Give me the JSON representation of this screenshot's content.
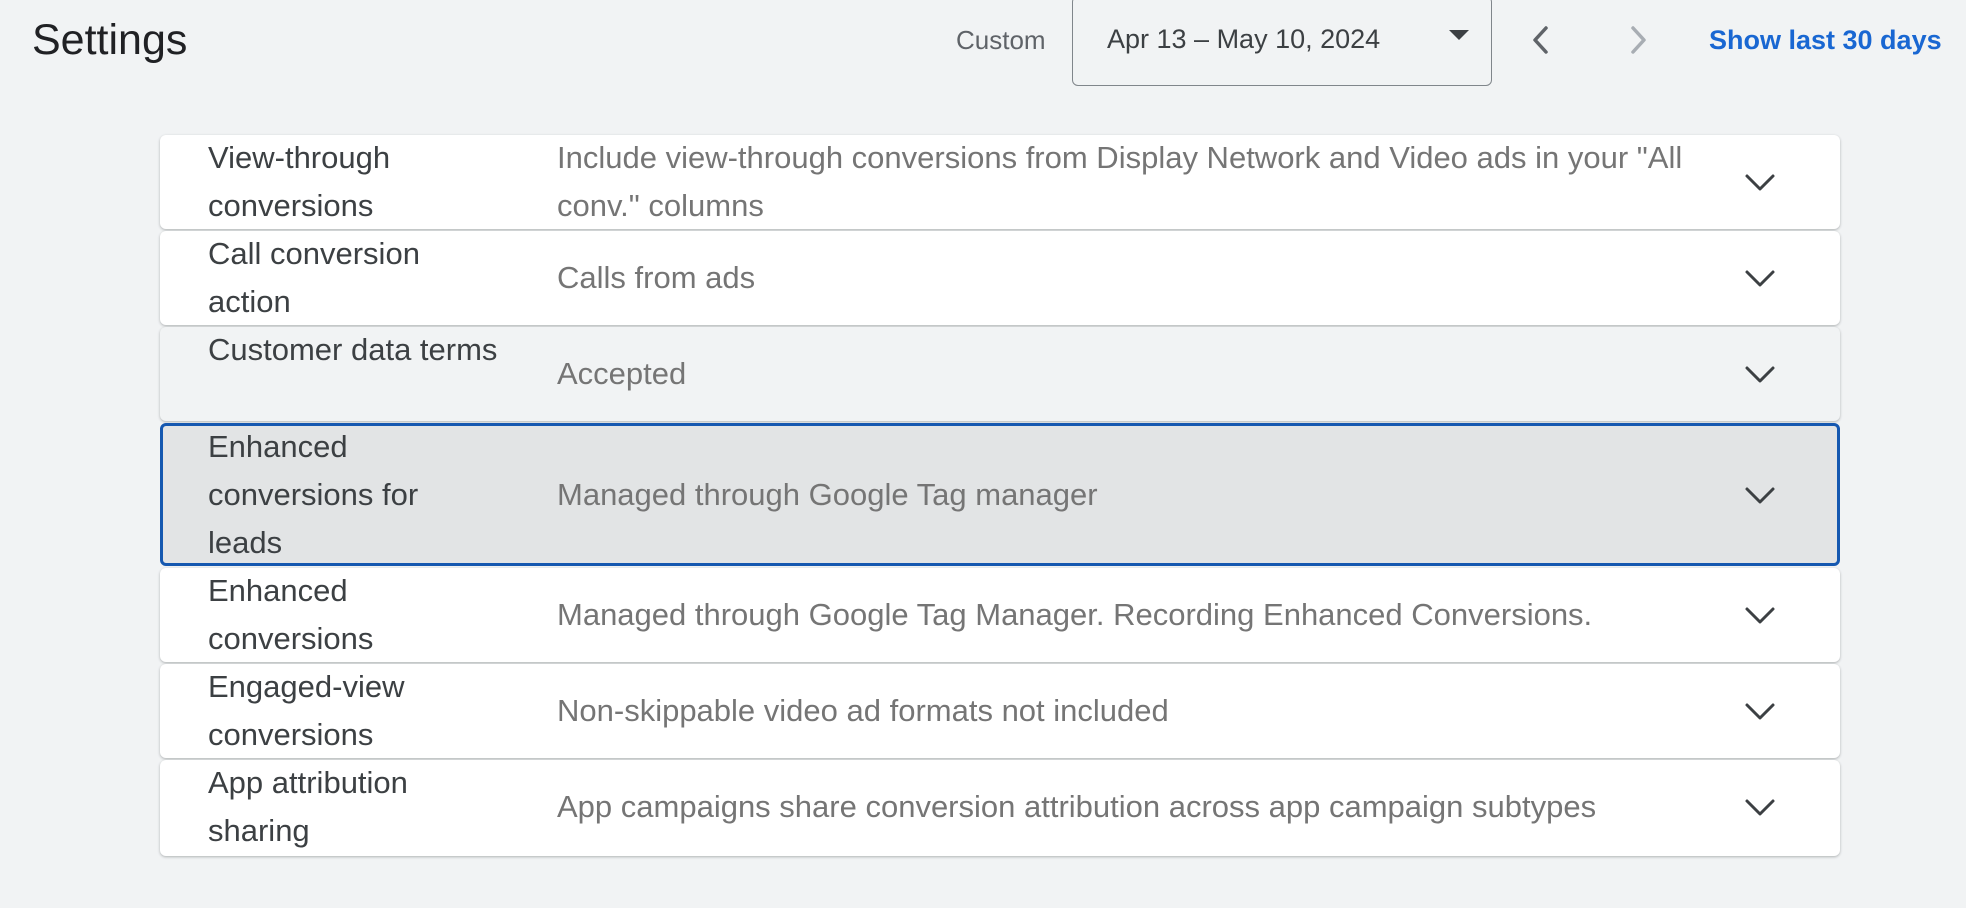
{
  "header": {
    "title": "Settings",
    "date_range_label": "Custom",
    "date_range_value": "Apr 13 – May 10, 2024",
    "show_last_label": "Show last 30 days"
  },
  "icons": {
    "date_dropdown": "caret-down-icon",
    "previous": "chevron-left-icon",
    "next": "chevron-right-icon",
    "expand": "chevron-down-icon"
  },
  "colors": {
    "background": "#f1f3f4",
    "link": "#1967d2",
    "selected_border": "#1558b0",
    "selected_background": "#e2e4e5",
    "value_text": "#757575"
  },
  "settings": {
    "rows": [
      {
        "name": "View-through conversions",
        "value": "Include view-through conversions from Display Network and Video ads in your \"All conv.\" columns"
      },
      {
        "name": "Call conversion action",
        "value": "Calls from ads"
      },
      {
        "name": "Customer data terms",
        "value": "Accepted"
      },
      {
        "name": "Enhanced conversions for leads",
        "value": "Managed through Google Tag manager"
      },
      {
        "name": "Enhanced conversions",
        "value": "Managed through Google Tag Manager. Recording Enhanced Conversions."
      },
      {
        "name": "Engaged-view conversions",
        "value": "Non-skippable video ad formats not included"
      },
      {
        "name": "App attribution sharing",
        "value": "App campaigns share conversion attribution across app campaign subtypes"
      }
    ]
  }
}
